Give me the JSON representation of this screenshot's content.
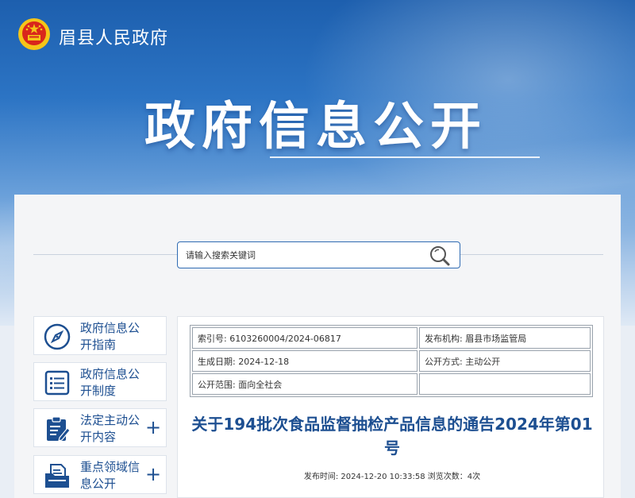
{
  "header": {
    "site_name": "眉县人民政府",
    "banner_title": "政府信息公开"
  },
  "search": {
    "placeholder": "请输入搜索关键词"
  },
  "sidebar": {
    "items": [
      {
        "label": "政府信息公开指南",
        "icon": "compass-icon",
        "expandable": false
      },
      {
        "label": "政府信息公开制度",
        "icon": "document-list-icon",
        "expandable": false
      },
      {
        "label": "法定主动公开内容",
        "icon": "clipboard-edit-icon",
        "expandable": true
      },
      {
        "label": "重点领域信息公开",
        "icon": "folder-docs-icon",
        "expandable": true
      }
    ],
    "expand_symbol": "+"
  },
  "article": {
    "meta": {
      "index_no": "索引号: 6103260004/2024-06817",
      "publisher": "发布机构: 眉县市场监管局",
      "created": "生成日期: 2024-12-18",
      "disclosure_mode": "公开方式: 主动公开",
      "disclosure_scope": "公开范围: 面向全社会"
    },
    "title": "关于194批次食品监督抽检产品信息的通告2024年第01号",
    "publish_info": "发布时间: 2024-12-20 10:33:58  浏览次数：4次"
  },
  "colors": {
    "primary": "#1d4f91",
    "banner_top": "#1d5fae",
    "emblem_red": "#d9261c",
    "emblem_gold": "#f5c518"
  }
}
